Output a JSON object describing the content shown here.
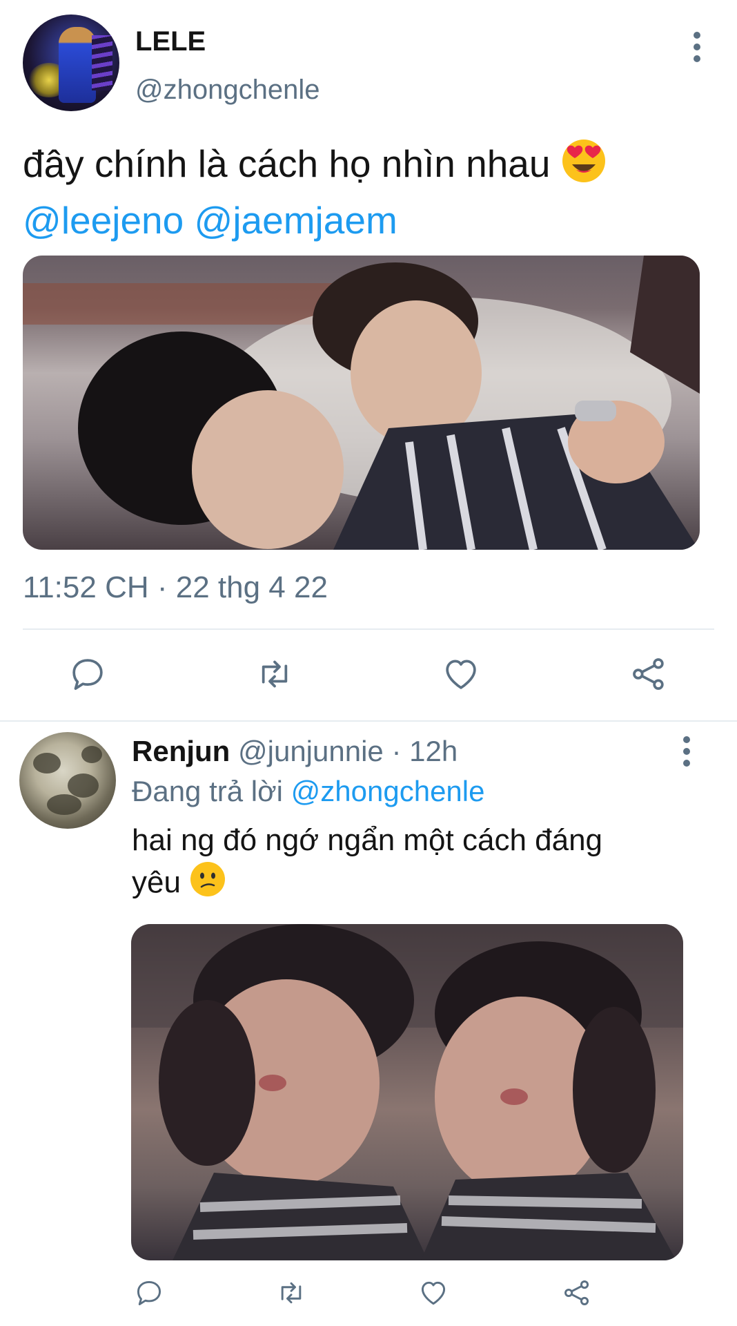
{
  "main_tweet": {
    "name": "LELE",
    "handle": "@zhongchenle",
    "text": "đây chính là cách họ nhìn nhau",
    "mentions": [
      "@leejeno",
      "@jaemjaem"
    ],
    "emoji": "smiling-face-with-heart-eyes",
    "timestamp": "11:52 CH · 22 thg 4 22",
    "actions": [
      "reply-icon",
      "retweet-icon",
      "like-icon",
      "share-icon"
    ]
  },
  "reply_tweet": {
    "name": "Renjun",
    "handle": "@junjunnie",
    "time": "· 12h",
    "replying_label": "Đang trả lời",
    "replying_to": "@zhongchenle",
    "text_line1": "hai ng đó ngớ ngẩn một cách đáng",
    "text_line2": "yêu",
    "emoji": "confused-face",
    "actions": [
      "reply-icon",
      "retweet-icon",
      "like-icon",
      "share-icon"
    ]
  },
  "colors": {
    "accent": "#1d9bf0",
    "secondary_text": "#5b7083",
    "primary_text": "#141414",
    "divider": "#e6ecf0"
  }
}
